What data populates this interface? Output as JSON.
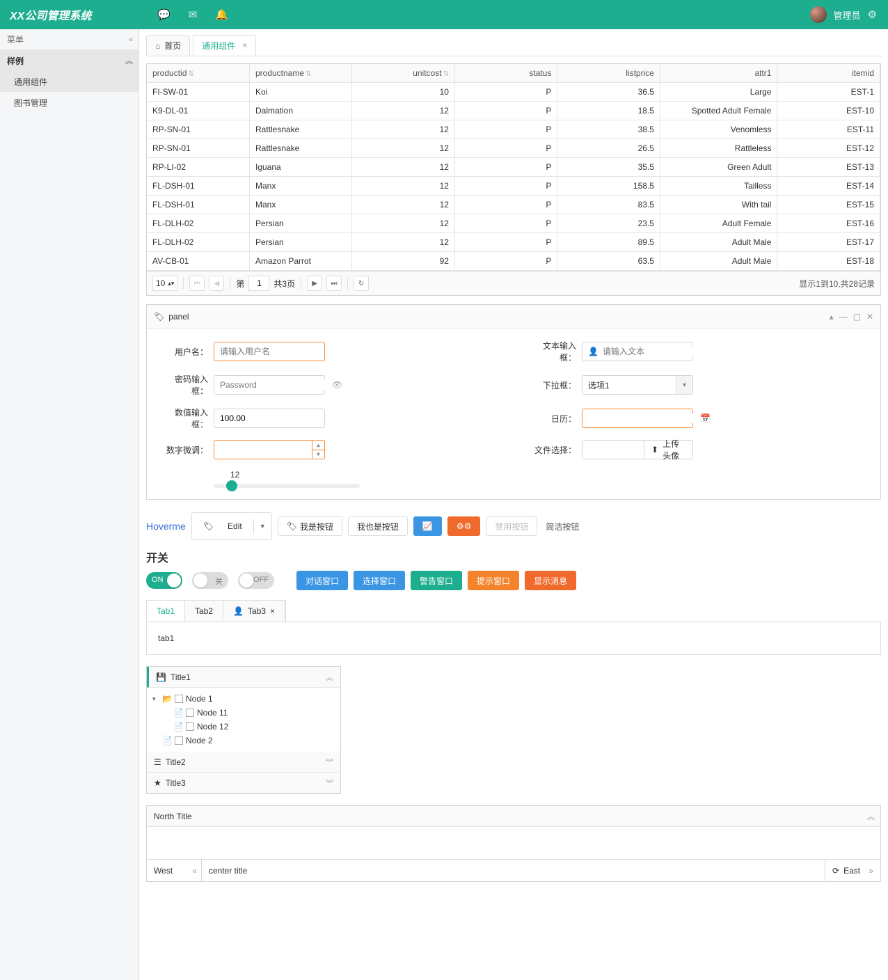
{
  "header": {
    "logo": "XX公司管理系统",
    "user": "管理员"
  },
  "sidebar": {
    "title": "菜单",
    "group": "样例",
    "items": [
      "通用组件",
      "图书管理"
    ]
  },
  "tabs": {
    "t0": "首页",
    "t1": "通用组件"
  },
  "grid": {
    "headers": {
      "productid": "productid",
      "productname": "productname",
      "unitcost": "unitcost",
      "status": "status",
      "listprice": "listprice",
      "attr1": "attr1",
      "itemid": "itemid"
    },
    "rows": [
      {
        "productid": "FI-SW-01",
        "productname": "Koi",
        "unitcost": "10",
        "status": "P",
        "listprice": "36.5",
        "attr1": "Large",
        "itemid": "EST-1"
      },
      {
        "productid": "K9-DL-01",
        "productname": "Dalmation",
        "unitcost": "12",
        "status": "P",
        "listprice": "18.5",
        "attr1": "Spotted Adult Female",
        "itemid": "EST-10"
      },
      {
        "productid": "RP-SN-01",
        "productname": "Rattlesnake",
        "unitcost": "12",
        "status": "P",
        "listprice": "38.5",
        "attr1": "Venomless",
        "itemid": "EST-11"
      },
      {
        "productid": "RP-SN-01",
        "productname": "Rattlesnake",
        "unitcost": "12",
        "status": "P",
        "listprice": "26.5",
        "attr1": "Rattleless",
        "itemid": "EST-12"
      },
      {
        "productid": "RP-LI-02",
        "productname": "Iguana",
        "unitcost": "12",
        "status": "P",
        "listprice": "35.5",
        "attr1": "Green Adult",
        "itemid": "EST-13"
      },
      {
        "productid": "FL-DSH-01",
        "productname": "Manx",
        "unitcost": "12",
        "status": "P",
        "listprice": "158.5",
        "attr1": "Tailless",
        "itemid": "EST-14"
      },
      {
        "productid": "FL-DSH-01",
        "productname": "Manx",
        "unitcost": "12",
        "status": "P",
        "listprice": "83.5",
        "attr1": "With tail",
        "itemid": "EST-15"
      },
      {
        "productid": "FL-DLH-02",
        "productname": "Persian",
        "unitcost": "12",
        "status": "P",
        "listprice": "23.5",
        "attr1": "Adult Female",
        "itemid": "EST-16"
      },
      {
        "productid": "FL-DLH-02",
        "productname": "Persian",
        "unitcost": "12",
        "status": "P",
        "listprice": "89.5",
        "attr1": "Adult Male",
        "itemid": "EST-17"
      },
      {
        "productid": "AV-CB-01",
        "productname": "Amazon Parrot",
        "unitcost": "92",
        "status": "P",
        "listprice": "63.5",
        "attr1": "Adult Male",
        "itemid": "EST-18"
      }
    ],
    "pager": {
      "size": "10",
      "pagePrefix": "第",
      "pageVal": "1",
      "totalPages": "共3页",
      "info": "显示1到10,共28记录"
    }
  },
  "panel": {
    "title": "panel",
    "labels": {
      "username": "用户名：",
      "text": "文本输入框：",
      "password": "密码输入框：",
      "select": "下拉框：",
      "number": "数值输入框：",
      "calendar": "日历：",
      "spinner": "数字微调：",
      "file": "文件选择：",
      "slider": "12"
    },
    "ph": {
      "username": "请输入用户名",
      "text": "请输入文本",
      "password": "Password"
    },
    "values": {
      "select": "选项1",
      "number": "100.00",
      "filebtn": "上传头像"
    }
  },
  "buttons": {
    "hoverme": "Hoverme",
    "edit": "Edit",
    "b1": "我是按钮",
    "b2": "我也是按钮",
    "disabled": "禁用按钮",
    "plain": "简洁按钮",
    "switchTitle": "开关",
    "on": "ON",
    "off": "关",
    "off2": "OFF",
    "dlg": "对话窗口",
    "sel": "选择窗口",
    "warn": "警告窗口",
    "tip": "提示窗口",
    "msg": "显示消息"
  },
  "itabs": {
    "t1": "Tab1",
    "t2": "Tab2",
    "t3": "Tab3",
    "body": "tab1"
  },
  "accordion": {
    "t1": "Title1",
    "t2": "Title2",
    "t3": "Title3",
    "tree": {
      "n1": "Node 1",
      "n11": "Node 11",
      "n12": "Node 12",
      "n2": "Node 2"
    }
  },
  "layout": {
    "north": "North Title",
    "west": "West",
    "center": "center title",
    "east": "East"
  }
}
